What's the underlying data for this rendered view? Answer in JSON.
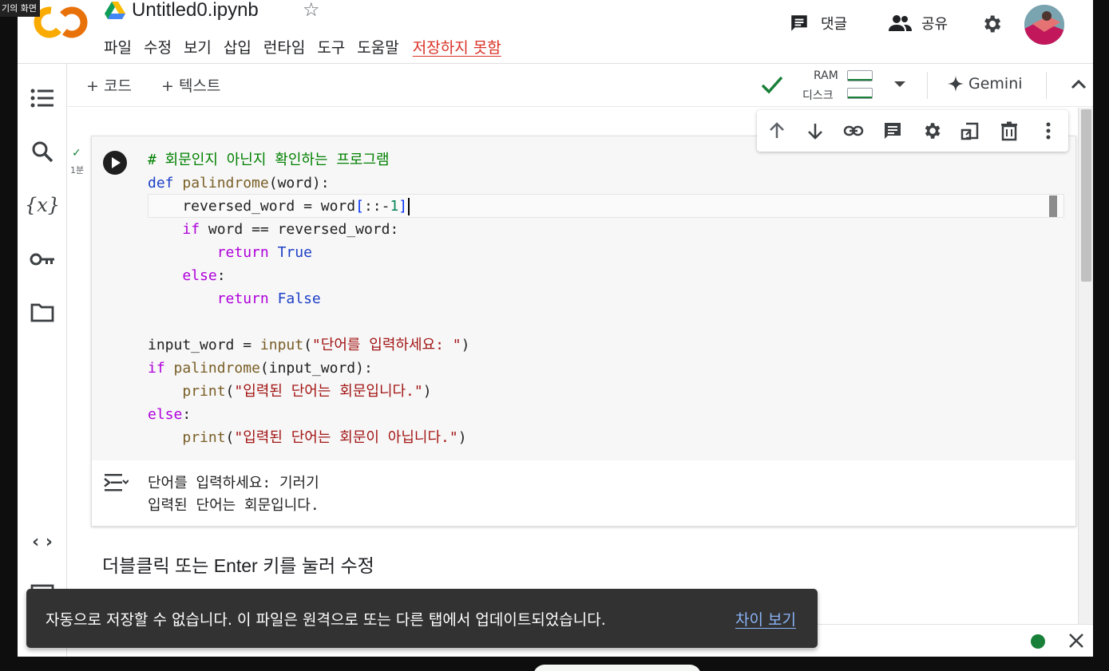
{
  "screen_share_label": "기의 화면",
  "header": {
    "title": "Untitled0.ipynb",
    "menu": [
      "파일",
      "수정",
      "보기",
      "삽입",
      "런타임",
      "도구",
      "도움말"
    ],
    "unsaved_label": "저장하지 못함",
    "comment_label": "댓글",
    "share_label": "공유"
  },
  "toolbar": {
    "add_code": "+ 코드",
    "add_text": "+ 텍스트",
    "ram_label": "RAM",
    "disk_label": "디스크",
    "gemini_label": "Gemini"
  },
  "cell": {
    "exec_time": "1분",
    "code_lines": [
      "# 회문인지 아닌지 확인하는 프로그램",
      "def palindrome(word):",
      "    reversed_word = word[::-1]",
      "    if word == reversed_word:",
      "        return True",
      "    else:",
      "        return False",
      "",
      "input_word = input(\"단어를 입력하세요: \")",
      "if palindrome(input_word):",
      "    print(\"입력된 단어는 회문입니다.\")",
      "else:",
      "    print(\"입력된 단어는 회문이 아닙니다.\")"
    ],
    "output_lines": [
      "단어를 입력하세요: 기러기",
      "입력된 단어는 회문입니다."
    ]
  },
  "text_cell": "더블클릭 또는 Enter 키를 눌러 수정",
  "snackbar": {
    "message": "자동으로 저장할 수 없습니다. 이 파일은 원격으로 또는 다른 탭에서 업데이트되었습니다.",
    "action": "차이 보기"
  },
  "icons": {
    "left_rail": [
      "toc-icon",
      "search-icon",
      "variables-icon",
      "secrets-key-icon",
      "folder-icon",
      "code-snippets-icon"
    ],
    "cell_toolbar": [
      "arrow-up-icon",
      "arrow-down-icon",
      "link-icon",
      "comment-icon",
      "gear-icon",
      "mirror-cell-icon",
      "delete-icon",
      "more-vert-icon"
    ]
  },
  "colors": {
    "accent_green": "#188038",
    "unsaved_red": "#d93025",
    "snackbar_bg": "#323232",
    "link_blue": "#8ab4f8"
  }
}
